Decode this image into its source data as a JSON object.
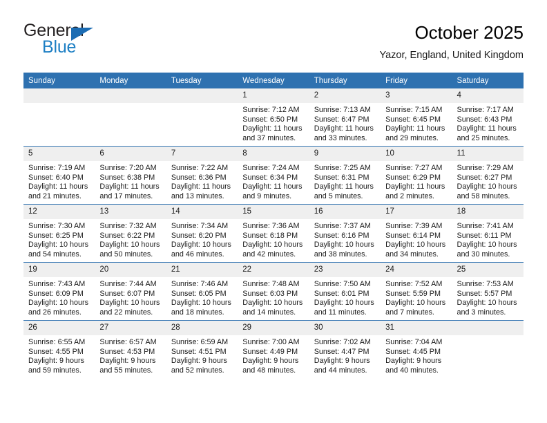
{
  "brand": {
    "name_top": "General",
    "name_bottom": "Blue",
    "triangle_color": "#1b6cb3",
    "blue_text_color": "#1d7fc4"
  },
  "header": {
    "title": "October 2025",
    "subtitle": "Yazor, England, United Kingdom"
  },
  "theme": {
    "header_band": "#2e71b0",
    "daynum_band": "#efefef",
    "row_divider": "#2e71b0",
    "text": "#1a1a1a"
  },
  "weekday_headers": [
    "Sunday",
    "Monday",
    "Tuesday",
    "Wednesday",
    "Thursday",
    "Friday",
    "Saturday"
  ],
  "weeks": [
    [
      {
        "date": "",
        "lines": []
      },
      {
        "date": "",
        "lines": []
      },
      {
        "date": "",
        "lines": []
      },
      {
        "date": "1",
        "lines": [
          "Sunrise: 7:12 AM",
          "Sunset: 6:50 PM",
          "Daylight: 11 hours",
          "and 37 minutes."
        ]
      },
      {
        "date": "2",
        "lines": [
          "Sunrise: 7:13 AM",
          "Sunset: 6:47 PM",
          "Daylight: 11 hours",
          "and 33 minutes."
        ]
      },
      {
        "date": "3",
        "lines": [
          "Sunrise: 7:15 AM",
          "Sunset: 6:45 PM",
          "Daylight: 11 hours",
          "and 29 minutes."
        ]
      },
      {
        "date": "4",
        "lines": [
          "Sunrise: 7:17 AM",
          "Sunset: 6:43 PM",
          "Daylight: 11 hours",
          "and 25 minutes."
        ]
      }
    ],
    [
      {
        "date": "5",
        "lines": [
          "Sunrise: 7:19 AM",
          "Sunset: 6:40 PM",
          "Daylight: 11 hours",
          "and 21 minutes."
        ]
      },
      {
        "date": "6",
        "lines": [
          "Sunrise: 7:20 AM",
          "Sunset: 6:38 PM",
          "Daylight: 11 hours",
          "and 17 minutes."
        ]
      },
      {
        "date": "7",
        "lines": [
          "Sunrise: 7:22 AM",
          "Sunset: 6:36 PM",
          "Daylight: 11 hours",
          "and 13 minutes."
        ]
      },
      {
        "date": "8",
        "lines": [
          "Sunrise: 7:24 AM",
          "Sunset: 6:34 PM",
          "Daylight: 11 hours",
          "and 9 minutes."
        ]
      },
      {
        "date": "9",
        "lines": [
          "Sunrise: 7:25 AM",
          "Sunset: 6:31 PM",
          "Daylight: 11 hours",
          "and 5 minutes."
        ]
      },
      {
        "date": "10",
        "lines": [
          "Sunrise: 7:27 AM",
          "Sunset: 6:29 PM",
          "Daylight: 11 hours",
          "and 2 minutes."
        ]
      },
      {
        "date": "11",
        "lines": [
          "Sunrise: 7:29 AM",
          "Sunset: 6:27 PM",
          "Daylight: 10 hours",
          "and 58 minutes."
        ]
      }
    ],
    [
      {
        "date": "12",
        "lines": [
          "Sunrise: 7:30 AM",
          "Sunset: 6:25 PM",
          "Daylight: 10 hours",
          "and 54 minutes."
        ]
      },
      {
        "date": "13",
        "lines": [
          "Sunrise: 7:32 AM",
          "Sunset: 6:22 PM",
          "Daylight: 10 hours",
          "and 50 minutes."
        ]
      },
      {
        "date": "14",
        "lines": [
          "Sunrise: 7:34 AM",
          "Sunset: 6:20 PM",
          "Daylight: 10 hours",
          "and 46 minutes."
        ]
      },
      {
        "date": "15",
        "lines": [
          "Sunrise: 7:36 AM",
          "Sunset: 6:18 PM",
          "Daylight: 10 hours",
          "and 42 minutes."
        ]
      },
      {
        "date": "16",
        "lines": [
          "Sunrise: 7:37 AM",
          "Sunset: 6:16 PM",
          "Daylight: 10 hours",
          "and 38 minutes."
        ]
      },
      {
        "date": "17",
        "lines": [
          "Sunrise: 7:39 AM",
          "Sunset: 6:14 PM",
          "Daylight: 10 hours",
          "and 34 minutes."
        ]
      },
      {
        "date": "18",
        "lines": [
          "Sunrise: 7:41 AM",
          "Sunset: 6:11 PM",
          "Daylight: 10 hours",
          "and 30 minutes."
        ]
      }
    ],
    [
      {
        "date": "19",
        "lines": [
          "Sunrise: 7:43 AM",
          "Sunset: 6:09 PM",
          "Daylight: 10 hours",
          "and 26 minutes."
        ]
      },
      {
        "date": "20",
        "lines": [
          "Sunrise: 7:44 AM",
          "Sunset: 6:07 PM",
          "Daylight: 10 hours",
          "and 22 minutes."
        ]
      },
      {
        "date": "21",
        "lines": [
          "Sunrise: 7:46 AM",
          "Sunset: 6:05 PM",
          "Daylight: 10 hours",
          "and 18 minutes."
        ]
      },
      {
        "date": "22",
        "lines": [
          "Sunrise: 7:48 AM",
          "Sunset: 6:03 PM",
          "Daylight: 10 hours",
          "and 14 minutes."
        ]
      },
      {
        "date": "23",
        "lines": [
          "Sunrise: 7:50 AM",
          "Sunset: 6:01 PM",
          "Daylight: 10 hours",
          "and 11 minutes."
        ]
      },
      {
        "date": "24",
        "lines": [
          "Sunrise: 7:52 AM",
          "Sunset: 5:59 PM",
          "Daylight: 10 hours",
          "and 7 minutes."
        ]
      },
      {
        "date": "25",
        "lines": [
          "Sunrise: 7:53 AM",
          "Sunset: 5:57 PM",
          "Daylight: 10 hours",
          "and 3 minutes."
        ]
      }
    ],
    [
      {
        "date": "26",
        "lines": [
          "Sunrise: 6:55 AM",
          "Sunset: 4:55 PM",
          "Daylight: 9 hours",
          "and 59 minutes."
        ]
      },
      {
        "date": "27",
        "lines": [
          "Sunrise: 6:57 AM",
          "Sunset: 4:53 PM",
          "Daylight: 9 hours",
          "and 55 minutes."
        ]
      },
      {
        "date": "28",
        "lines": [
          "Sunrise: 6:59 AM",
          "Sunset: 4:51 PM",
          "Daylight: 9 hours",
          "and 52 minutes."
        ]
      },
      {
        "date": "29",
        "lines": [
          "Sunrise: 7:00 AM",
          "Sunset: 4:49 PM",
          "Daylight: 9 hours",
          "and 48 minutes."
        ]
      },
      {
        "date": "30",
        "lines": [
          "Sunrise: 7:02 AM",
          "Sunset: 4:47 PM",
          "Daylight: 9 hours",
          "and 44 minutes."
        ]
      },
      {
        "date": "31",
        "lines": [
          "Sunrise: 7:04 AM",
          "Sunset: 4:45 PM",
          "Daylight: 9 hours",
          "and 40 minutes."
        ]
      },
      {
        "date": "",
        "lines": []
      }
    ]
  ]
}
